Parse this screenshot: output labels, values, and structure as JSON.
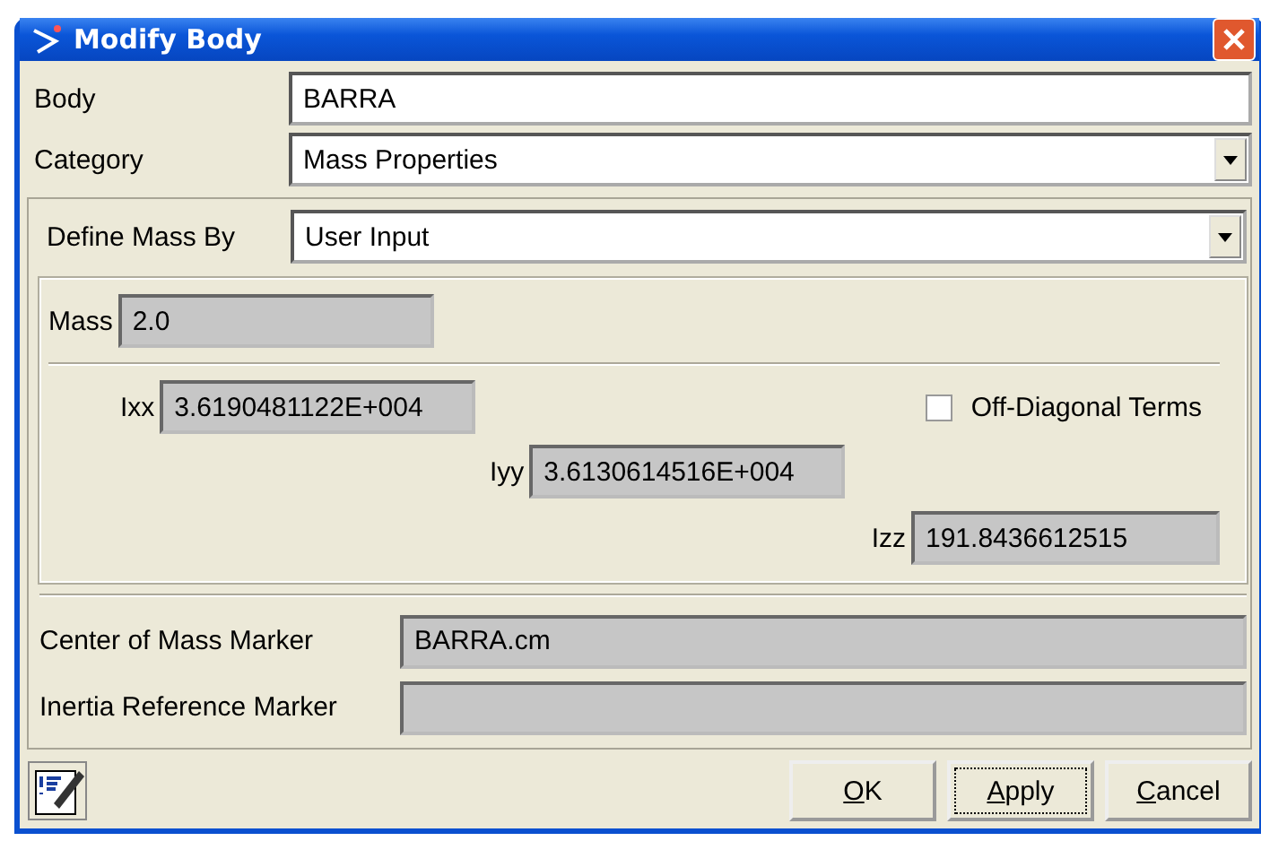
{
  "window": {
    "title": "Modify Body"
  },
  "body": {
    "label": "Body",
    "value": "BARRA"
  },
  "category": {
    "label": "Category",
    "value": "Mass Properties"
  },
  "define_mass_by": {
    "label": "Define Mass By",
    "value": "User Input"
  },
  "mass": {
    "label": "Mass",
    "value": "2.0"
  },
  "ixx": {
    "label": "Ixx",
    "value": "3.6190481122E+004"
  },
  "off_diagonal_terms": {
    "label": "Off-Diagonal Terms",
    "checked": false
  },
  "iyy": {
    "label": "Iyy",
    "value": "3.6130614516E+004"
  },
  "izz": {
    "label": "Izz",
    "value": "191.8436612515"
  },
  "markers": [
    {
      "label": "Center of Mass Marker",
      "value": "BARRA.cm"
    },
    {
      "label": "Inertia Reference Marker"
    }
  ],
  "buttons": [
    {
      "label": "OK",
      "focused": false
    },
    {
      "label": "Apply",
      "focused": true
    },
    {
      "label": "Cancel",
      "focused": false
    }
  ]
}
